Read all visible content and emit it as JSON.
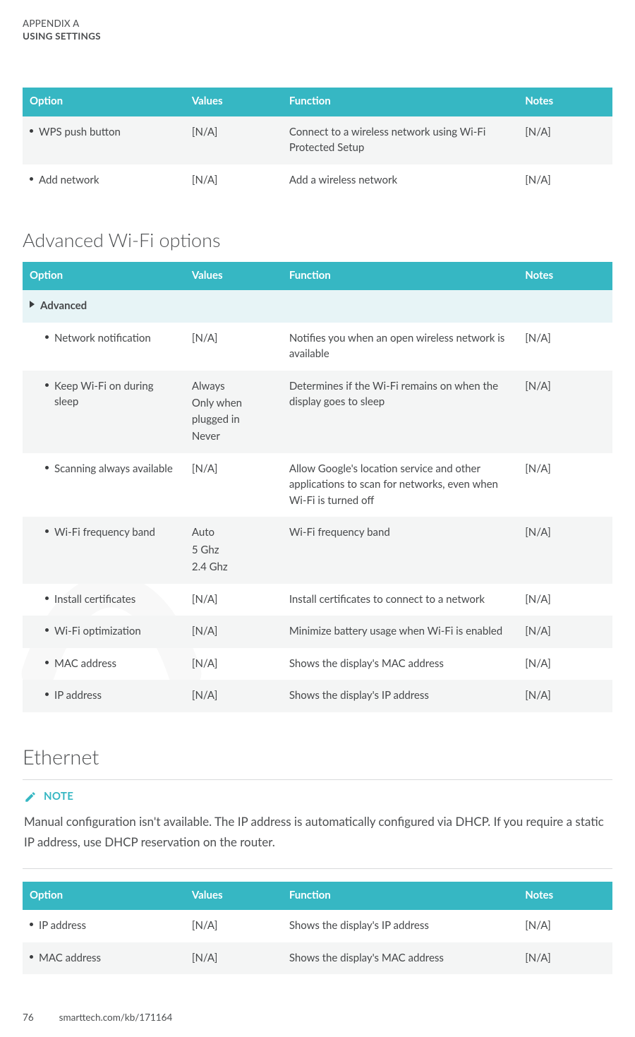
{
  "running_head": {
    "appendix": "APPENDIX A",
    "title": "USING SETTINGS"
  },
  "columns": {
    "option": "Option",
    "values": "Values",
    "function": "Function",
    "notes": "Notes"
  },
  "na": "[N/A]",
  "table1": {
    "rows": [
      {
        "option": "WPS push button",
        "values": "[N/A]",
        "function": "Connect to a wireless network using Wi-Fi Protected Setup",
        "notes": "[N/A]"
      },
      {
        "option": "Add network",
        "values": "[N/A]",
        "function": "Add a wireless network",
        "notes": "[N/A]"
      }
    ]
  },
  "section_wifi_title": "Advanced Wi-Fi options",
  "table2": {
    "group": "Advanced",
    "rows": [
      {
        "option": "Network notification",
        "values": [
          "[N/A]"
        ],
        "function": "Notifies you when an open wireless network is available",
        "notes": "[N/A]"
      },
      {
        "option": "Keep Wi-Fi on during sleep",
        "values": [
          "Always",
          "Only when plugged in",
          "Never"
        ],
        "function": "Determines if the Wi-Fi remains on when the display goes to sleep",
        "notes": "[N/A]"
      },
      {
        "option": "Scanning always available",
        "values": [
          "[N/A]"
        ],
        "function": "Allow Google's location service and other applications to scan for networks, even when Wi-Fi is turned off",
        "notes": "[N/A]"
      },
      {
        "option": "Wi-Fi frequency band",
        "values": [
          "Auto",
          "5 Ghz",
          "2.4 Ghz"
        ],
        "function": "Wi-Fi frequency band",
        "notes": "[N/A]"
      },
      {
        "option": "Install certificates",
        "values": [
          "[N/A]"
        ],
        "function": "Install certificates to connect to a network",
        "notes": "[N/A]"
      },
      {
        "option": "Wi-Fi optimization",
        "values": [
          "[N/A]"
        ],
        "function": "Minimize battery usage when Wi-Fi is enabled",
        "notes": "[N/A]"
      },
      {
        "option": "MAC address",
        "values": [
          "[N/A]"
        ],
        "function": "Shows the display's MAC address",
        "notes": "[N/A]"
      },
      {
        "option": "IP address",
        "values": [
          "[N/A]"
        ],
        "function": "Shows the display's IP address",
        "notes": "[N/A]"
      }
    ]
  },
  "section_eth_title": "Ethernet",
  "note": {
    "label": "NOTE",
    "body": "Manual configuration isn't available. The IP address is automatically configured via DHCP. If you require a static IP address, use DHCP reservation on the router."
  },
  "table3": {
    "rows": [
      {
        "option": "IP address",
        "values": "[N/A]",
        "function": "Shows the display's IP address",
        "notes": "[N/A]"
      },
      {
        "option": "MAC address",
        "values": "[N/A]",
        "function": "Shows the display's MAC address",
        "notes": "[N/A]"
      }
    ]
  },
  "footer": {
    "page": "76",
    "url": "smarttech.com/kb/171164"
  }
}
